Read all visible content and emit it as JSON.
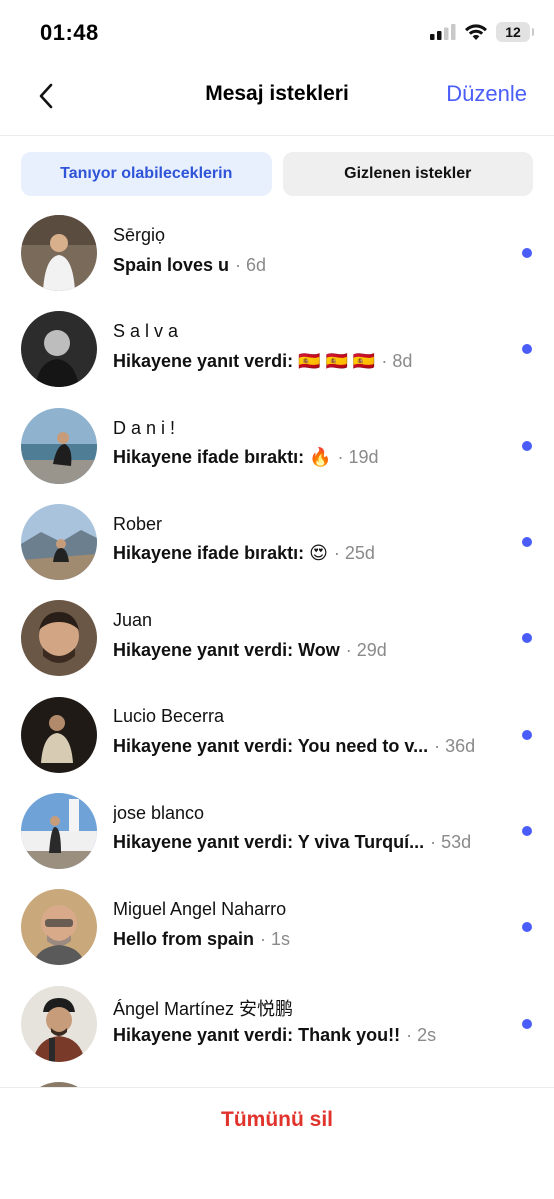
{
  "status_bar": {
    "time": "01:48",
    "battery": "12"
  },
  "nav": {
    "title": "Mesaj istekleri",
    "edit_label": "Düzenle"
  },
  "tabs": [
    {
      "label": "Tanıyor olabileceklerin",
      "active": true
    },
    {
      "label": "Gizlenen istekler",
      "active": false
    }
  ],
  "requests": [
    {
      "name": "Sērgiọ",
      "message": "Spain loves u",
      "time": "· 6d",
      "unread": true
    },
    {
      "name": "S a l v a",
      "message": "Hikayene yanıt verdi: 🇪🇸 🇪🇸 🇪🇸",
      "time": "· 8d",
      "unread": true
    },
    {
      "name": "D a n i !",
      "message": "Hikayene ifade bıraktı: 🔥",
      "time": "· 19d",
      "unread": true
    },
    {
      "name": "Rober",
      "message": "Hikayene ifade bıraktı: 😍",
      "time": "· 25d",
      "unread": true
    },
    {
      "name": "Juan",
      "message": "Hikayene yanıt verdi: Wow",
      "time": "· 29d",
      "unread": true
    },
    {
      "name": "Lucio Becerra",
      "message": "Hikayene yanıt verdi: You need to v...",
      "time": "· 36d",
      "unread": true
    },
    {
      "name": "jose blanco",
      "message": "Hikayene yanıt verdi: Y viva Turquí...",
      "time": "· 53d",
      "unread": true
    },
    {
      "name": "Miguel Angel Naharro",
      "message": "Hello from spain",
      "time": "· 1s",
      "unread": true
    },
    {
      "name": "Ángel Martínez 安悦鹏",
      "message": "Hikayene yanıt verdi: Thank you!!",
      "time": "· 2s",
      "unread": true
    }
  ],
  "footer": {
    "delete_all_label": "Tümünü sil"
  },
  "colors": {
    "accent": "#4a5df9",
    "danger": "#e0332c",
    "tab_active_bg": "#e8effd"
  }
}
